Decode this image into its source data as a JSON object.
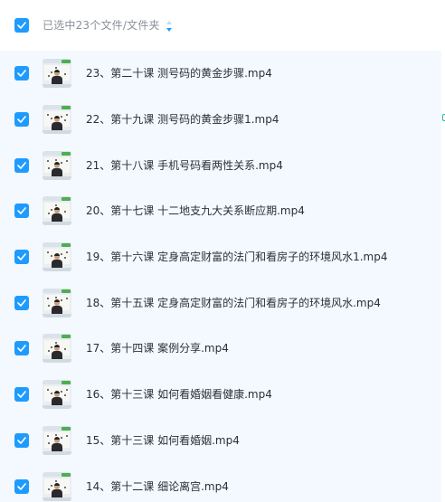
{
  "header": {
    "checked": true,
    "title": "已选中23个文件/文件夹",
    "sort_icon": "sort-arrows-icon"
  },
  "files": [
    {
      "name": "23、第二十课 测号码的黄金步骤.mp4",
      "checked": true
    },
    {
      "name": "22、第十九课 测号码的黄金步骤1.mp4",
      "checked": true
    },
    {
      "name": "21、第十八课 手机号码看两性关系.mp4",
      "checked": true
    },
    {
      "name": "20、第十七课 十二地支九大关系断应期.mp4",
      "checked": true
    },
    {
      "name": "19、第十六课 定身高定财富的法门和看房子的环境风水1.mp4",
      "checked": true
    },
    {
      "name": "18、第十五课 定身高定财富的法门和看房子的环境风水.mp4",
      "checked": true
    },
    {
      "name": "17、第十四课 案例分享.mp4",
      "checked": true
    },
    {
      "name": "16、第十三课 如何看婚姻看健康.mp4",
      "checked": true
    },
    {
      "name": "15、第十三课 如何看婚姻.mp4",
      "checked": true
    },
    {
      "name": "14、第十二课 细论离宫.mp4",
      "checked": true
    }
  ],
  "colors": {
    "accent": "#1e9bff",
    "list_bg": "#f4f9ff",
    "header_text": "#8a8f99",
    "file_text": "#2b2f36"
  }
}
